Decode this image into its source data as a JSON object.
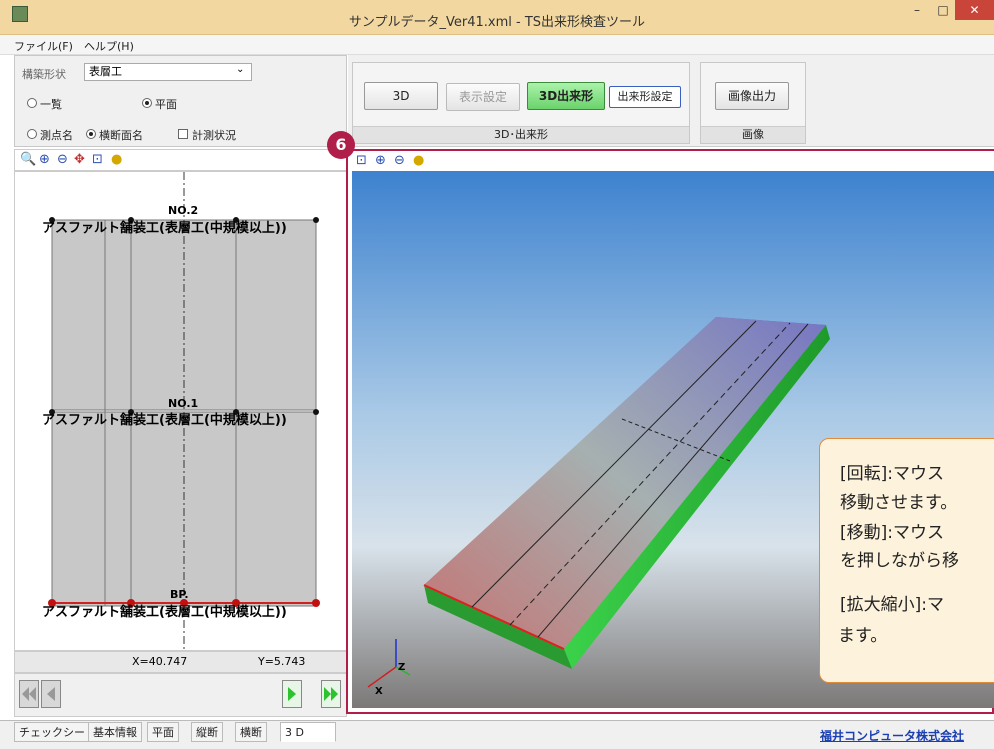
{
  "window": {
    "title": "サンプルデータ_Ver41.xml - TS出来形検査ツール",
    "min_glyph": "–",
    "max_glyph": "□",
    "close_glyph": "✕"
  },
  "menu": [
    "ファイル(F)",
    "ヘルプ(H)"
  ],
  "left_panel": {
    "kozo_label": "構築形状",
    "kozo_value": "表層工",
    "radio_list": "一覧",
    "radio_plan": "平面",
    "radio_point": "測点名",
    "radio_section": "横断面名",
    "check_measure": "計測状況",
    "plan_labels": {
      "no2": "NO.2",
      "no1": "NO.1",
      "bp": "BP.",
      "pavement": "アスファルト舗装工(表層工(中規模以上))"
    },
    "coords": {
      "x": "X=40.747",
      "y": "Y=5.743"
    }
  },
  "ribbon": {
    "btn_3d": "3D",
    "btn_display": "表示設定",
    "btn_3d_dekigata": "3D出来形",
    "btn_dekigata_settings": "出来形設定",
    "group_3d": "3D･出来形",
    "btn_image_output": "画像出力",
    "group_image": "画像"
  },
  "step_badge": "6",
  "axis": {
    "z": "Z",
    "x": "X"
  },
  "callout": {
    "line1": "[回転]:マウス",
    "line2": "移動させます。",
    "line3": "[移動]:マウス",
    "line4": "を押しながら移",
    "line5": "[拡大縮小]:マ",
    "line6": "ます。"
  },
  "tabs": [
    "チェックシート",
    "基本情報",
    "平面",
    "縦断",
    "横断",
    "3 D"
  ],
  "company": "福井コンピュータ株式会社",
  "colors": {
    "accent": "#b01e4a",
    "title_bar": "#f2d8a0",
    "link": "#1a3fb0"
  }
}
